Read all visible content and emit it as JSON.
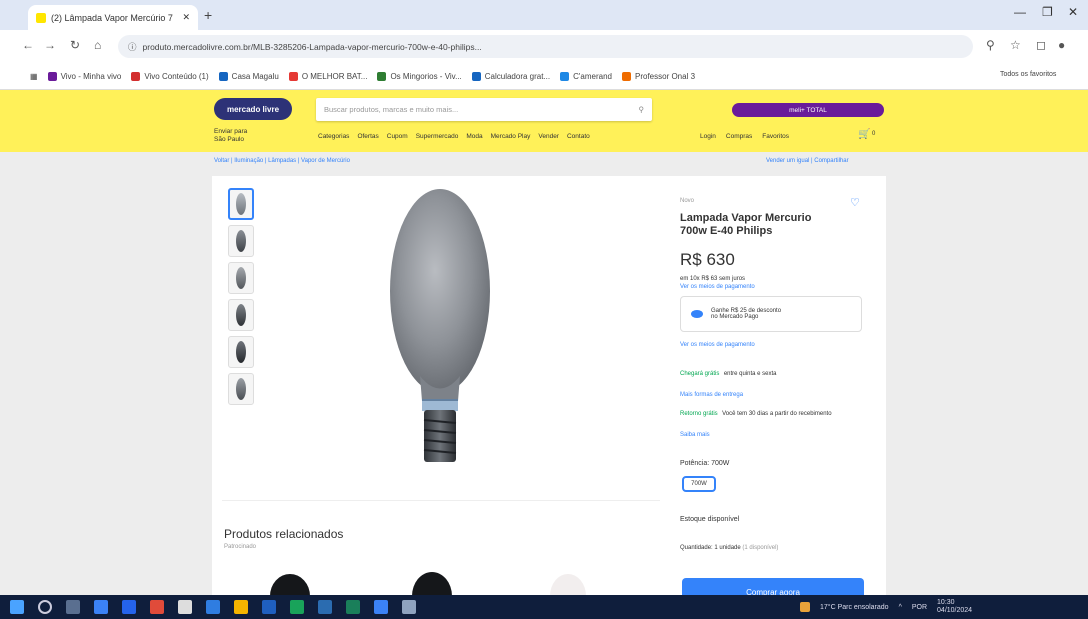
{
  "browser": {
    "tab_title": "(2) Lâmpada Vapor Mercúrio 7",
    "new_tab": "+",
    "url": "produto.mercadolivre.com.br/MLB-3285206-Lampada-vapor-mercurio-700w-e-40-philips...",
    "bookmarks": [
      {
        "label": "Vivo - Minha vivo",
        "color": "#6a1b9a"
      },
      {
        "label": "Vivo Conteúdo (1)",
        "color": "#d32f2f"
      },
      {
        "label": "Casa Magalu",
        "color": "#1565c0"
      },
      {
        "label": "O MELHOR BAT...",
        "color": "#e53935"
      },
      {
        "label": "Os Mingorios - Viv...",
        "color": "#2e7d32"
      },
      {
        "label": "Calculadora grat...",
        "color": "#1565c0"
      },
      {
        "label": "C'amerand",
        "color": "#1e88e5"
      },
      {
        "label": "Professor Onal 3",
        "color": "#ef6c00"
      }
    ],
    "all_bookmarks": "Todos os favoritos"
  },
  "ml": {
    "logo": "mercado livre",
    "search_placeholder": "Buscar produtos, marcas e muito mais...",
    "promo": "meli+ TOTAL",
    "ship_line1": "Enviar para",
    "ship_line2": "São Paulo",
    "nav": [
      "Categorias",
      "Ofertas",
      "Cupom",
      "Supermercado",
      "Moda",
      "Mercado Play",
      "Vender",
      "Contato"
    ],
    "right_nav": [
      "Login",
      "Compras",
      "Favoritos"
    ],
    "cart_count": "0"
  },
  "breadcrumb": "Voltar | Iluminação | Lâmpadas | Vapor de Mercúrio",
  "breadcrumb_right": "Vender um igual | Compartilhar",
  "product": {
    "condition": "Novo",
    "title": "Lampada Vapor Mercurio 700w E-40 Philips",
    "price": "R$ 630",
    "installments": "em 10x R$ 63 sem juros",
    "installments_link": "Ver os meios de pagamento",
    "discount_line1": "Ganhe R$ 25 de desconto",
    "discount_line2": "no Mercado Pago",
    "payment_link": "Ver os meios de pagamento",
    "shipping_green": "Chegará grátis",
    "shipping_text": "entre quinta e sexta",
    "shipping_link": "Mais formas de entrega",
    "return_green": "Retorno grátis",
    "return_text": "Você tem 30 dias a partir do recebimento",
    "return_link": "Saiba mais",
    "potencia_label": "Potência: 700W",
    "potencia_option": "700W",
    "stock": "Estoque disponível",
    "qty_label": "Quantidade: 1 unidade",
    "qty_note": "(1 disponível)",
    "buy_button": "Comprar agora"
  },
  "related": {
    "title": "Produtos relacionados",
    "subtitle": "Patrocinado"
  },
  "taskbar": {
    "weather": "17°C Parc ensolarado",
    "lang": "POR",
    "time": "10:30",
    "date": "04/10/2024"
  },
  "colors": {
    "ml_yellow": "#fff159",
    "ml_blue": "#3483fa",
    "ml_green": "#00a650"
  }
}
